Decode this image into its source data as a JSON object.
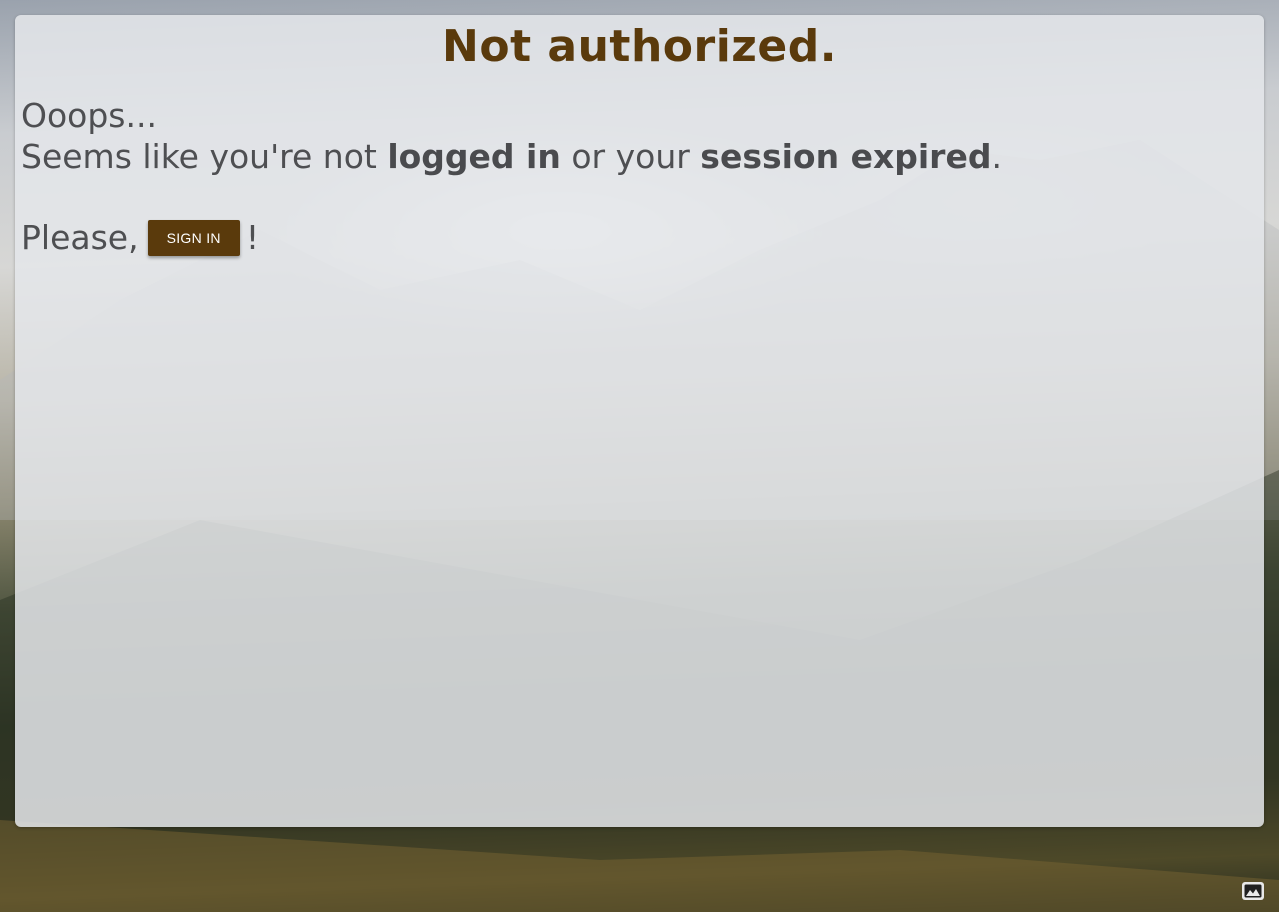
{
  "page": {
    "title": "Not authorized.",
    "line1": "Ooops...",
    "line2_pre": "Seems like you're not ",
    "line2_bold1": "logged in",
    "line2_mid": " or your ",
    "line2_bold2": "session expired",
    "line2_post": ".",
    "please": "Please,",
    "exclaim": "!"
  },
  "buttons": {
    "sign_in": "SIGN IN"
  },
  "icons": {
    "corner": "image-icon"
  },
  "colors": {
    "accent": "#5a3a0c",
    "text": "#4e4f52"
  }
}
